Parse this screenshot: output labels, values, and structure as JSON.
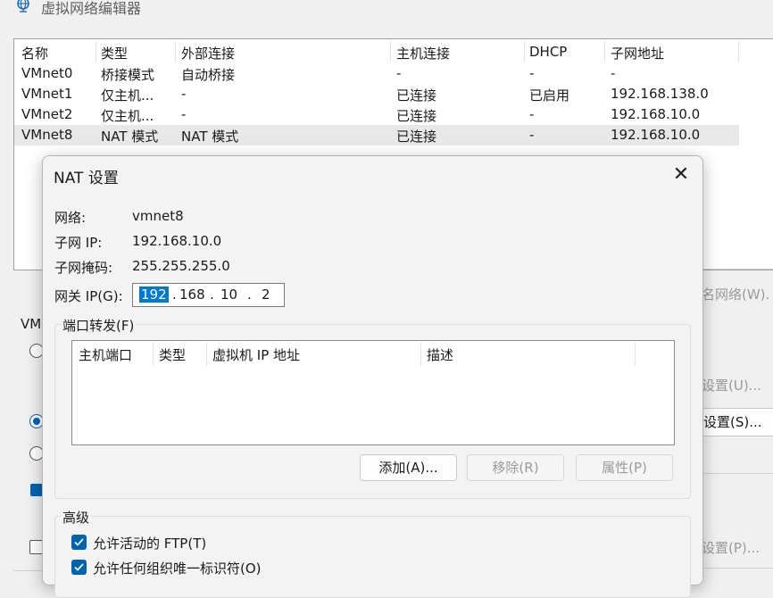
{
  "window": {
    "title": "虚拟网络编辑器",
    "icon": "network-globe-icon"
  },
  "network_table": {
    "columns": [
      "名称",
      "类型",
      "外部连接",
      "主机连接",
      "DHCP",
      "子网地址"
    ],
    "rows": [
      {
        "name": "VMnet0",
        "type": "桥接模式",
        "external": "自动桥接",
        "host": "-",
        "dhcp": "-",
        "subnet": "-"
      },
      {
        "name": "VMnet1",
        "type": "仅主机...",
        "external": "-",
        "host": "已连接",
        "dhcp": "已启用",
        "subnet": "192.168.138.0"
      },
      {
        "name": "VMnet2",
        "type": "仅主机...",
        "external": "-",
        "host": "已连接",
        "dhcp": "-",
        "subnet": "192.168.10.0"
      },
      {
        "name": "VMnet8",
        "type": "NAT 模式",
        "external": "NAT 模式",
        "host": "已连接",
        "dhcp": "-",
        "subnet": "192.168.10.0",
        "selected": true
      }
    ]
  },
  "background": {
    "vm_label": "VMr",
    "rename_button": "名网络(W).",
    "settings_u_button": "设置(U)...",
    "settings_s_button": "设置(S)...",
    "settings_p_button": "设置(P)..."
  },
  "nat_dialog": {
    "title": "NAT 设置",
    "close_icon": "close-icon",
    "network_label": "网络:",
    "network_value": "vmnet8",
    "subnet_ip_label": "子网 IP:",
    "subnet_ip_value": "192.168.10.0",
    "subnet_mask_label": "子网掩码:",
    "subnet_mask_value": "255.255.255.0",
    "gateway_label": "网关 IP(G):",
    "gateway_octets": [
      "192",
      "168",
      "10",
      "2"
    ],
    "port_forwarding": {
      "title": "端口转发(F)",
      "columns": [
        "主机端口",
        "类型",
        "虚拟机 IP 地址",
        "描述"
      ],
      "add_button": "添加(A)...",
      "remove_button": "移除(R)",
      "properties_button": "属性(P)"
    },
    "advanced": {
      "title": "高级",
      "allow_ftp": "允许活动的 FTP(T)",
      "allow_oui": "允许任何组织唯一标识符(O)"
    }
  },
  "colors": {
    "accent": "#0063b1",
    "selection": "#0078d7",
    "row_highlight": "#e8e8e8"
  }
}
